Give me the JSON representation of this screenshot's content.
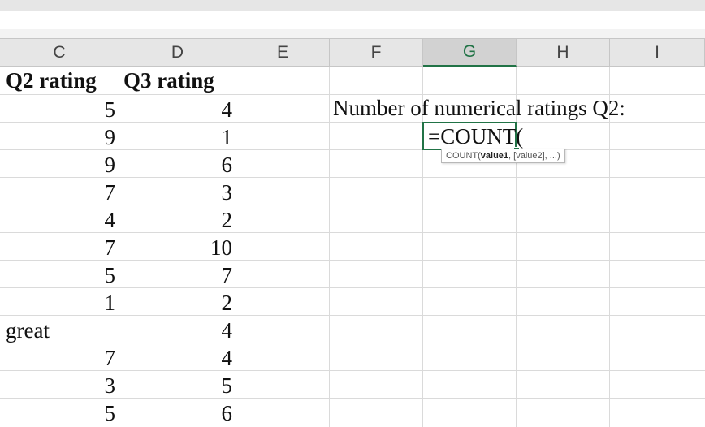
{
  "columns": [
    "C",
    "D",
    "E",
    "F",
    "G",
    "H",
    "I"
  ],
  "selected_column": "G",
  "headers": {
    "c": "Q2 rating",
    "d": "Q3 rating"
  },
  "rows": [
    {
      "c": "5",
      "d": "4"
    },
    {
      "c": "9",
      "d": "1"
    },
    {
      "c": "9",
      "d": "6"
    },
    {
      "c": "7",
      "d": "3"
    },
    {
      "c": "4",
      "d": "2"
    },
    {
      "c": "7",
      "d": "10"
    },
    {
      "c": "5",
      "d": "7"
    },
    {
      "c": "1",
      "d": "2"
    },
    {
      "c": "great",
      "d": "4"
    },
    {
      "c": "7",
      "d": "4"
    },
    {
      "c": "3",
      "d": "5"
    },
    {
      "c": "5",
      "d": "6"
    }
  ],
  "label_text": "Number of numerical ratings Q2:",
  "formula_text": "=COUNT(",
  "tooltip": {
    "fn": "COUNT(",
    "arg1": "value1",
    "rest": ", [value2], ...)"
  },
  "colors": {
    "accent": "#217346",
    "header_bg": "#e6e6e6",
    "gridline": "#dadada"
  }
}
